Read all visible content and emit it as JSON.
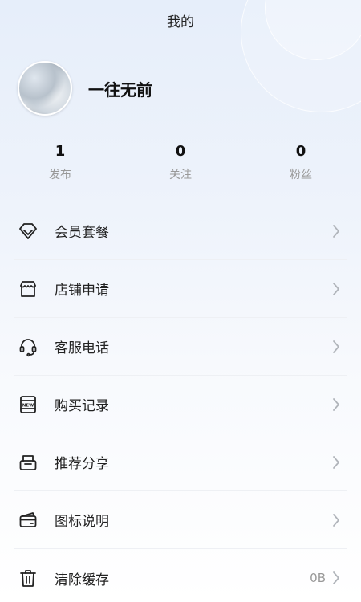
{
  "header": {
    "title": "我的"
  },
  "profile": {
    "name": "一往无前"
  },
  "stats": [
    {
      "value": "1",
      "label": "发布"
    },
    {
      "value": "0",
      "label": "关注"
    },
    {
      "value": "0",
      "label": "粉丝"
    }
  ],
  "menu": [
    {
      "label": "会员套餐",
      "icon": "diamond-icon",
      "extra": ""
    },
    {
      "label": "店铺申请",
      "icon": "store-icon",
      "extra": ""
    },
    {
      "label": "客服电话",
      "icon": "headset-icon",
      "extra": ""
    },
    {
      "label": "购买记录",
      "icon": "new-badge-icon",
      "extra": ""
    },
    {
      "label": "推荐分享",
      "icon": "mail-share-icon",
      "extra": ""
    },
    {
      "label": "图标说明",
      "icon": "card-icon",
      "extra": ""
    },
    {
      "label": "清除缓存",
      "icon": "trash-icon",
      "extra": "0B"
    }
  ],
  "colors": {
    "icon_stroke": "#222222",
    "chevron": "#b0b4ba",
    "muted_text": "#999999"
  }
}
